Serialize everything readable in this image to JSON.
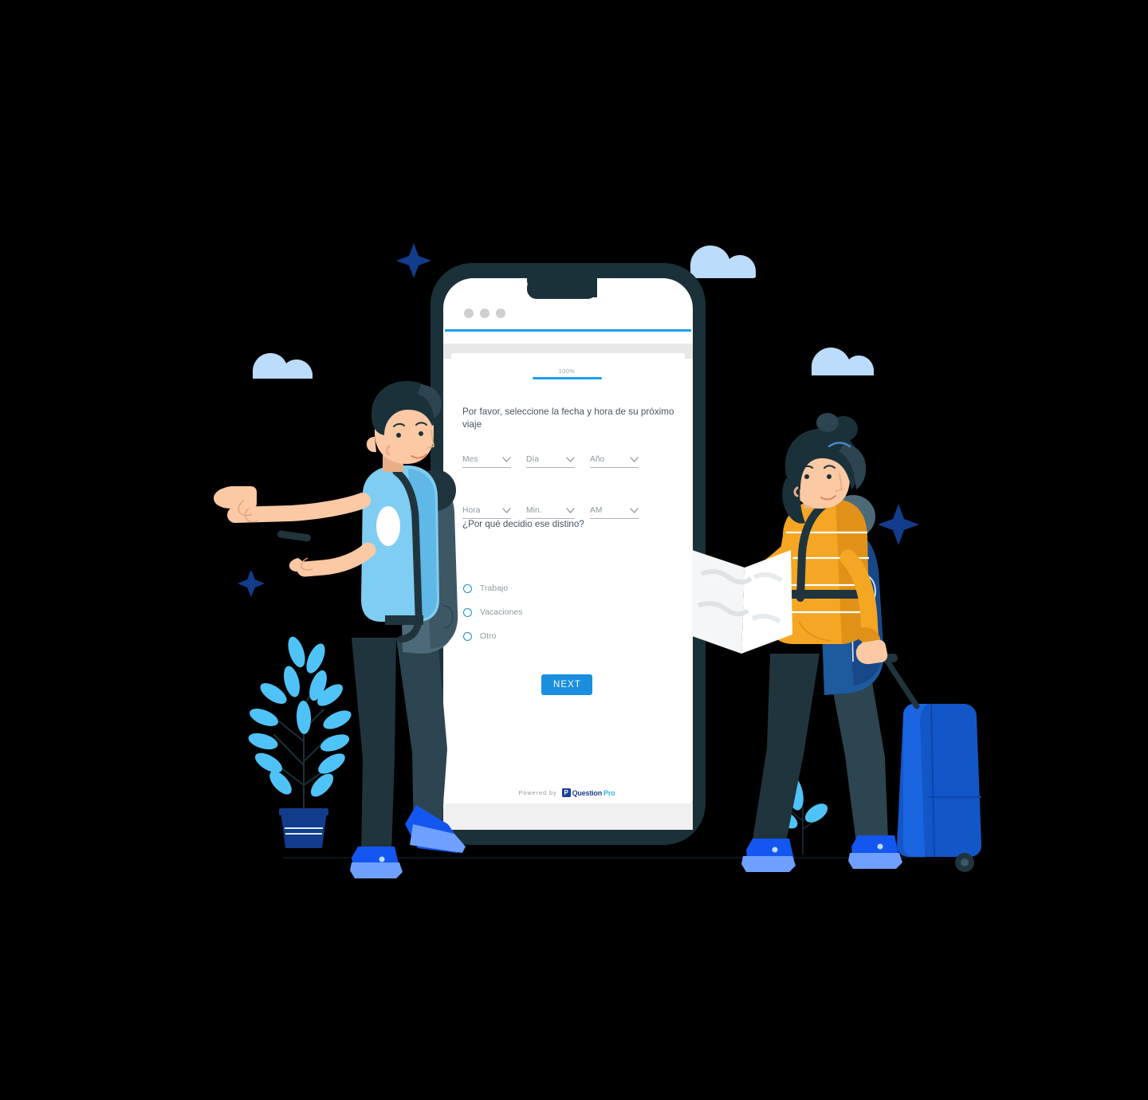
{
  "survey": {
    "progress": {
      "label": "100%",
      "percent": 100
    },
    "question1": {
      "text": "Por favor, seleccione la fecha y hora de su próximo viaje",
      "dropdowns_row1": [
        {
          "placeholder": "Mes",
          "icon": "chevron-down-icon"
        },
        {
          "placeholder": "Día",
          "icon": "chevron-down-icon"
        },
        {
          "placeholder": "Año",
          "icon": "chevron-down-icon"
        }
      ],
      "dropdowns_row2": [
        {
          "placeholder": "Hora",
          "icon": "chevron-down-icon"
        },
        {
          "placeholder": "Min.",
          "icon": "chevron-down-icon"
        },
        {
          "placeholder": "AM",
          "icon": "chevron-down-icon"
        }
      ]
    },
    "question2": {
      "text": "¿Por qué decidio ese distino?",
      "options": [
        {
          "label": "Trabajo",
          "selected": false
        },
        {
          "label": "Vacaciones",
          "selected": false
        },
        {
          "label": "Otro",
          "selected": false
        }
      ]
    },
    "next_button": "NEXT",
    "footer": {
      "powered_by": "Powered by",
      "brand_badge": "P",
      "brand_part1": "Question",
      "brand_part2": "Pro"
    },
    "browser_dots": 3
  },
  "colors": {
    "accent_blue": "#1a9ff0",
    "button_blue": "#1a8fe0",
    "phone_frame": "#1b313a",
    "text_dark": "#46545f",
    "text_muted": "#8d969d",
    "cloud": "#bcdcfb",
    "sparkle": "#123c8c",
    "shirt_blue": "#7fcdf2",
    "sweater_orange": "#f5a623",
    "suitcase_blue": "#1356c8",
    "leaf_blue": "#4fc3f7",
    "pot_navy": "#123c8c",
    "skin": "#fbc9a4",
    "hair_dark": "#1b313a",
    "backpack_slate": "#546e7a",
    "backpack_navy": "#1d5a9e",
    "pants_dark": "#20343d",
    "shoe_blue": "#1356f0"
  },
  "illustration": {
    "left_character": "traveler-man-pointing",
    "right_character": "traveler-woman-with-map-and-suitcase",
    "props": [
      "potted-plant",
      "small-sprout",
      "cloud-left",
      "cloud-top-right",
      "cloud-right",
      "sparkle-top-left",
      "sparkle-mid-left",
      "sparkle-right"
    ]
  }
}
